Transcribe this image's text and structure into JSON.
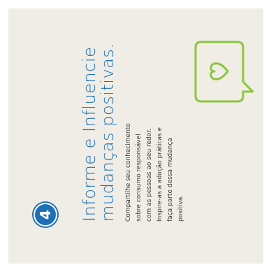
{
  "step": {
    "number": "4"
  },
  "heading": {
    "line1": "Informe e Influencie",
    "line2": "mudanças positivas."
  },
  "body": {
    "lines": [
      "Compartilhe seu conhecimento",
      "sobre consumo responsável",
      "com as pessoas ao seu redor.",
      "Inspire-as a adoção práticas e",
      "faça parte dessa mudança",
      "positiva."
    ]
  },
  "icons": {
    "bubble": "speech-bubble-heart-icon"
  },
  "colors": {
    "background": "#efede5",
    "accent_blue": "#1d6fb8",
    "accent_green": "#8cc63f",
    "text": "#3a3a3a"
  }
}
